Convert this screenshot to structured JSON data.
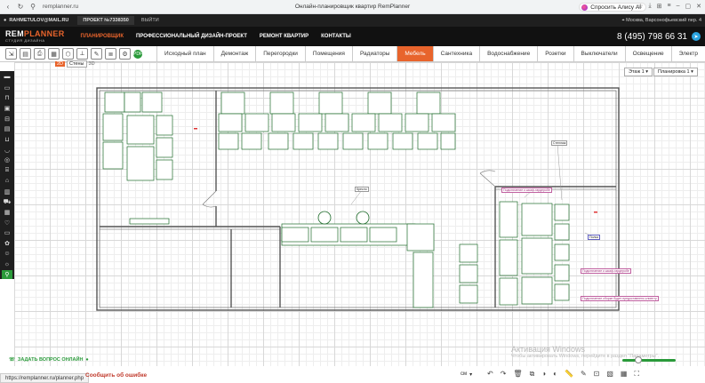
{
  "browser": {
    "url": "remplanner.ru",
    "title": "Онлайн-планировщик квартир RemPlanner",
    "alice_label": "Спросить Алису AI"
  },
  "site_top": {
    "email": "RAHMETULOV@MAIL.RU",
    "project": "ПРОЕКТ №7338350",
    "exit": "ВЫЙТИ",
    "location": "Москва, Варсонофьевский пер. 4"
  },
  "site_nav": {
    "logo_rem": "REM",
    "logo_planner": "PLANNER",
    "logo_sub": "СТУДИЯ ДИЗАЙНА",
    "menu": [
      "ПЛАНИРОВЩИК",
      "ПРОФЕССИОНАЛЬНЫЙ ДИЗАЙН-ПРОЕКТ",
      "РЕМОНТ КВАРТИР",
      "КОНТАКТЫ"
    ],
    "phone": "8 (495) 798 66 31"
  },
  "tool_tabs": [
    "Исходный план",
    "Демонтаж",
    "Перегородки",
    "Помещения",
    "Радиаторы",
    "Мебель",
    "Сантехника",
    "Водоснабжение",
    "Розетки",
    "Выключатели",
    "Освещение",
    "Электр"
  ],
  "active_tab": "Мебель",
  "mode_tip": {
    "badge": "2D",
    "label": "Стены",
    "alt": "3D"
  },
  "floor_select": "Этаж 1",
  "layout_select": "Планировка 1",
  "plan_labels": {
    "chair": "Кресло",
    "rack": "Стеллаж",
    "shelf": "Полка",
    "wall_in_2": "Подключение к шкаф-гардеробе",
    "wall_in_1": "Подключение к шкаф-гардеробе",
    "wall_in_3": "Подключение сборке будет предоставлено клиенту"
  },
  "bottom": {
    "ask": "ЗАДАТЬ ВОПРОС ОНЛАЙН",
    "status_url": "https://remplanner.ru/planner.php",
    "report": "Сообщить об ошибке",
    "unit": "см",
    "win_title": "Активация Windows",
    "win_sub": "Чтобы активировать Windows, перейдите в раздел \"Параметры\"."
  },
  "colors": {
    "accent": "#e8642c",
    "green": "#2a9a3a",
    "dark": "#1f1f1f"
  }
}
